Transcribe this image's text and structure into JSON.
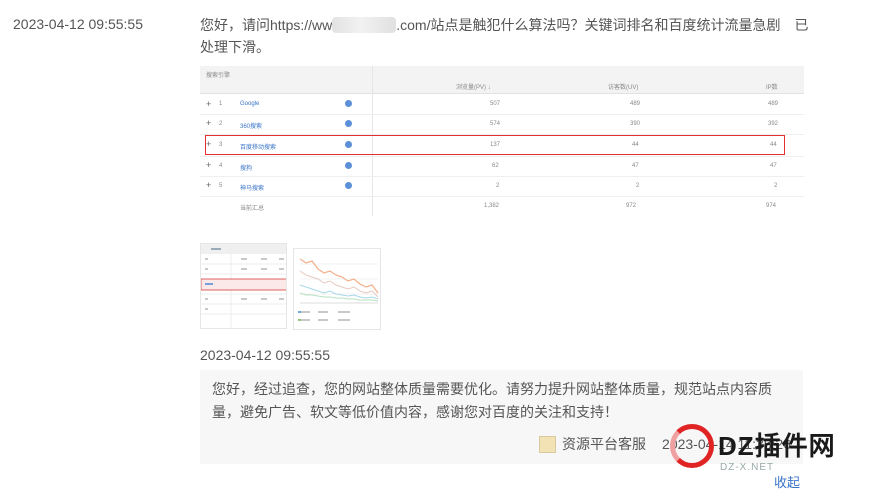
{
  "question": {
    "timestamp": "2023-04-12 09:55:55",
    "text_before": "您好，请问https://ww",
    "text_after": ".com/站点是触犯什么算法吗？关键词排名和百度统计流量急剧　已处理下滑。"
  },
  "stats_table": {
    "col_source": "搜索引擎",
    "col_pv": "浏览量(PV) ↓",
    "col_uv": "访客数(UV)",
    "col_ip": "IP数",
    "rows": [
      {
        "idx": "1",
        "name": "Google",
        "pv": "507",
        "uv": "489",
        "ip": "489"
      },
      {
        "idx": "2",
        "name": "360搜索",
        "pv": "574",
        "uv": "390",
        "ip": "392"
      },
      {
        "idx": "3",
        "name": "百度移动搜索",
        "pv": "137",
        "uv": "44",
        "ip": "44"
      },
      {
        "idx": "4",
        "name": "搜狗",
        "pv": "62",
        "uv": "47",
        "ip": "47"
      },
      {
        "idx": "5",
        "name": "神马搜索",
        "pv": "2",
        "uv": "2",
        "ip": "2"
      }
    ],
    "total_label": "当前汇总",
    "total_pv": "1,382",
    "total_uv": "972",
    "total_ip": "974"
  },
  "answer": {
    "timestamp": "2023-04-12 09:55:55",
    "text": "您好，经过追查，您的网站整体质量需要优化。请努力提升网站整体质量，规范站点内容质量，避免广告、软文等低价值内容，感谢您对百度的关注和支持！",
    "author": "资源平台客服",
    "reply_time": "2023-04-14 11:38:26"
  },
  "watermark": {
    "brand": "DZ插件网",
    "domain": "DZ-X.NET",
    "fold_label": "收起"
  },
  "colors": {
    "highlight": "#e03030",
    "link": "#3a74c8",
    "watermark_red": "#e02424"
  }
}
